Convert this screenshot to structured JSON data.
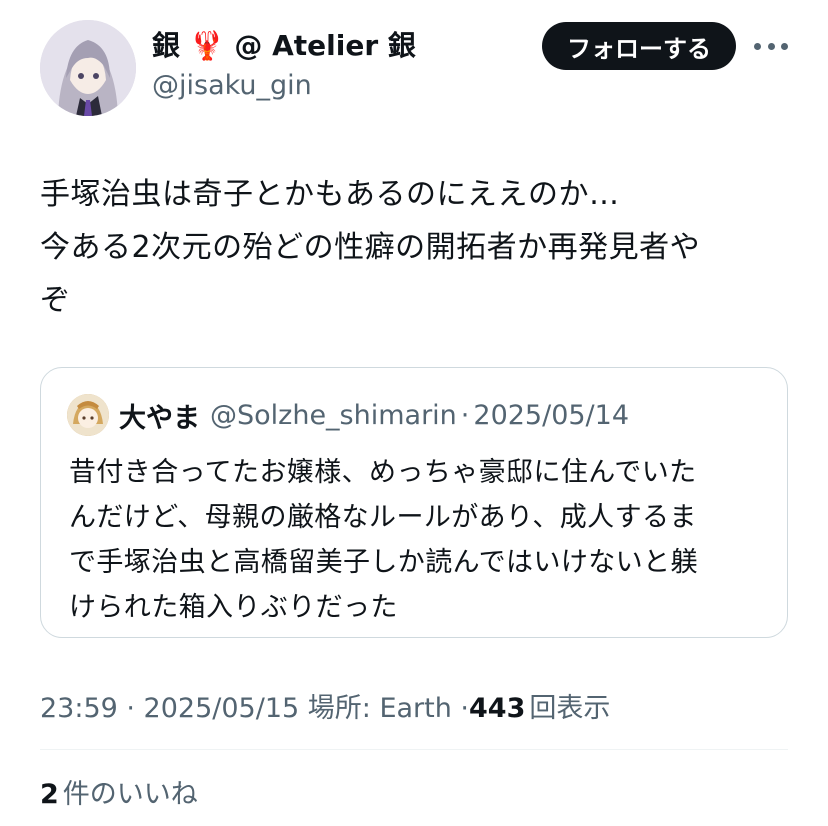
{
  "author": {
    "display_name": "銀 🦞 @ Atelier 銀",
    "handle": "@jisaku_gin",
    "follow_label": "フォローする"
  },
  "tweet": {
    "lines": [
      "手塚治虫は奇子とかもあるのにええのか…",
      "今ある2次元の殆どの性癖の開拓者か再発見者や",
      "ぞ"
    ]
  },
  "quote": {
    "name": "大やま",
    "handle": "@Solzhe_shimarin",
    "separator": "·",
    "date": "2025/05/14",
    "lines": [
      "昔付き合ってたお嬢様、めっちゃ豪邸に住んでいた",
      "んだけど、母親の厳格なルールがあり、成人するま",
      "で手塚治虫と高橋留美子しか読んではいけないと躾",
      "けられた箱入りぶりだった"
    ]
  },
  "meta": {
    "time_date_location": "23:59 · 2025/05/15 場所: Earth · ",
    "views_count": "443",
    "views_label": "回表示"
  },
  "likes": {
    "count": "2",
    "label": "件のいいね"
  },
  "colors": {
    "text": "#0f1419",
    "secondary": "#536471",
    "border": "#cfd9de",
    "button_bg": "#0f1419"
  },
  "icons": {
    "more": "more-icon",
    "avatar": "avatar",
    "quote_avatar": "quote-avatar"
  }
}
